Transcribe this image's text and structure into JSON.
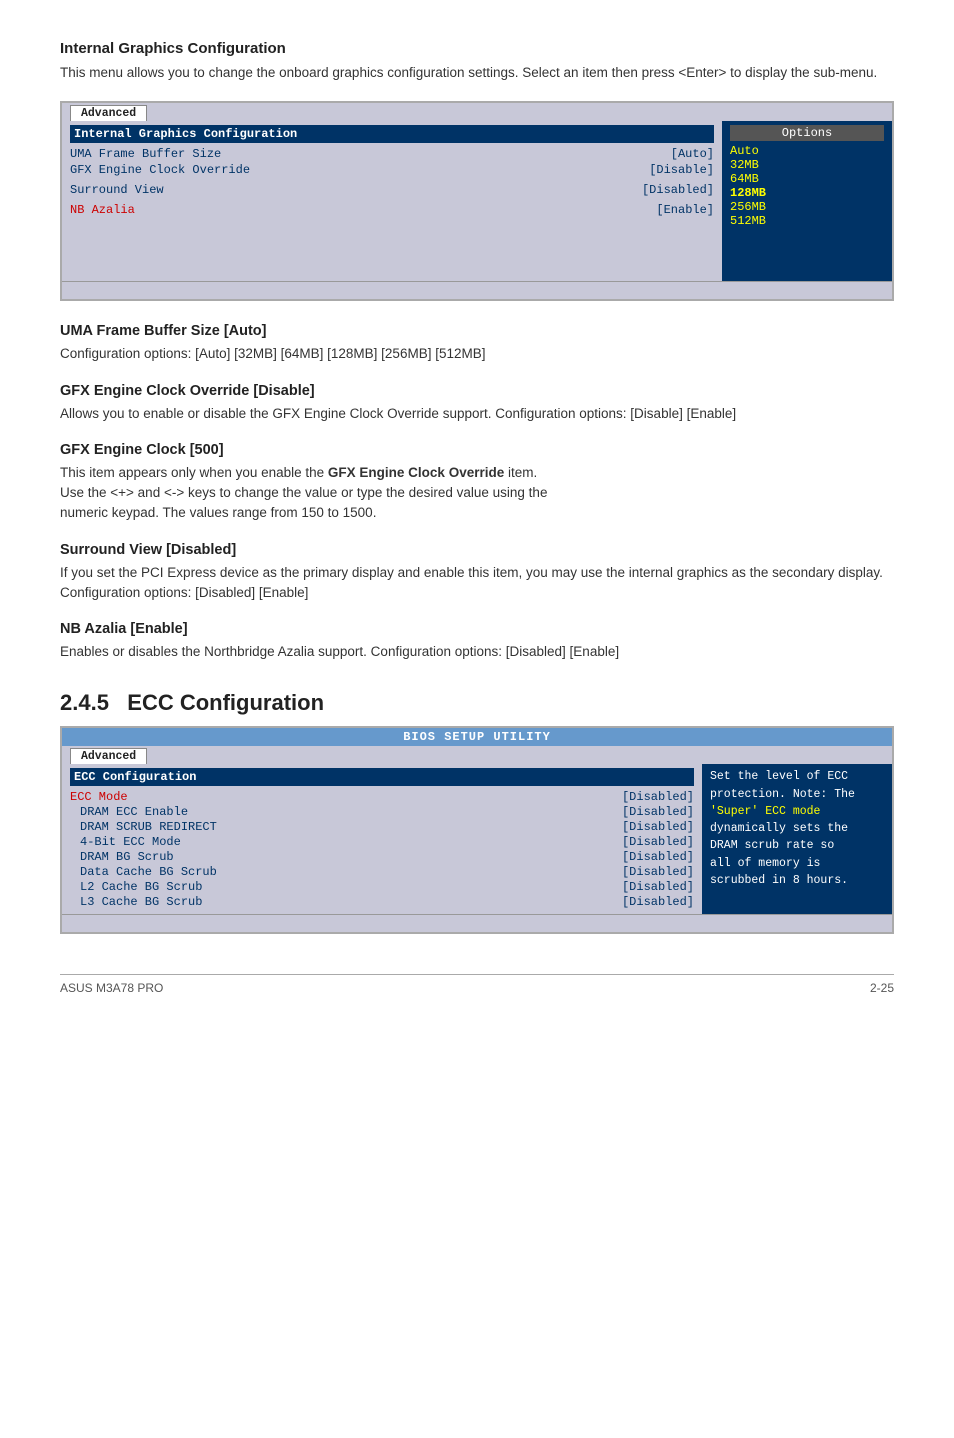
{
  "page": {
    "sections": [
      {
        "id": "internal-graphics",
        "title": "Internal Graphics Configuration",
        "body": "This menu allows you to change the onboard graphics configuration settings.\nSelect an item then press <Enter> to display the sub-menu."
      }
    ],
    "bios1": {
      "tab": "Advanced",
      "header": "Internal Graphics Configuration",
      "options_title": "Options",
      "rows": [
        {
          "label": "UMA Frame Buffer Size",
          "value": "[Auto]",
          "highlight": false
        },
        {
          "label": "GFX Engine Clock Override",
          "value": "[Disable]",
          "highlight": false
        },
        {
          "label": "Surround View",
          "value": "[Disabled]",
          "highlight": false
        },
        {
          "label": "NB Azalia",
          "value": "[Enable]",
          "highlight": true
        }
      ],
      "options": [
        "Auto",
        "32MB",
        "64MB",
        "128MB",
        "256MB",
        "512MB"
      ]
    },
    "subsections": [
      {
        "id": "uma-frame-buffer",
        "title": "UMA Frame Buffer Size [Auto]",
        "body": "Configuration options: [Auto] [32MB] [64MB] [128MB] [256MB] [512MB]"
      },
      {
        "id": "gfx-engine-clock-override",
        "title": "GFX Engine Clock Override [Disable]",
        "body": "Allows you to enable or disable the GFX Engine Clock Override support.\nConfiguration options: [Disable] [Enable]"
      },
      {
        "id": "gfx-engine-clock",
        "title": "GFX Engine Clock [500]",
        "body1": "This item appears only when you enable the ",
        "bold": "GFX Engine Clock Override",
        "body2": " item.\nUse the <+> and <-> keys to change the value or type the desired value using the\nnumeric keypad. The values range from 150 to 1500."
      },
      {
        "id": "surround-view",
        "title": "Surround View [Disabled]",
        "body": "If you set the PCI Express device as the primary display and enable this item, you\nmay use the internal graphics as the secondary display.\nConfiguration options: [Disabled] [Enable]"
      },
      {
        "id": "nb-azalia",
        "title": "NB Azalia [Enable]",
        "body": "Enables or disables the Northbridge Azalia support.\nConfiguration options: [Disabled] [Enable]"
      }
    ],
    "chapter": {
      "number": "2.4.5",
      "title": "ECC Configuration"
    },
    "bios2": {
      "header": "BIOS SETUP UTILITY",
      "tab": "Advanced",
      "section": "ECC Configuration",
      "rows": [
        {
          "label": "ECC Mode",
          "value": "[Disabled]",
          "sub": false
        },
        {
          "label": "DRAM ECC Enable",
          "value": "[Disabled]",
          "sub": true
        },
        {
          "label": "DRAM SCRUB REDIRECT",
          "value": "[Disabled]",
          "sub": true
        },
        {
          "label": "4-Bit ECC Mode",
          "value": "[Disabled]",
          "sub": true
        },
        {
          "label": "DRAM BG Scrub",
          "value": "[Disabled]",
          "sub": true
        },
        {
          "label": "Data Cache BG Scrub",
          "value": "[Disabled]",
          "sub": true
        },
        {
          "label": "L2 Cache BG Scrub",
          "value": "[Disabled]",
          "sub": true
        },
        {
          "label": "L3 Cache BG Scrub",
          "value": "[Disabled]",
          "sub": true
        }
      ],
      "sidebar": {
        "line1": "Set the level of ECC",
        "line2": "protection. Note: The",
        "line3": "'Super' ECC mode",
        "line4": "dynamically sets the",
        "line5": "DRAM scrub rate so",
        "line6": "all of memory is",
        "line7": "scrubbed in 8 hours."
      }
    },
    "footer": {
      "left": "ASUS M3A78 PRO",
      "right": "2-25"
    }
  }
}
